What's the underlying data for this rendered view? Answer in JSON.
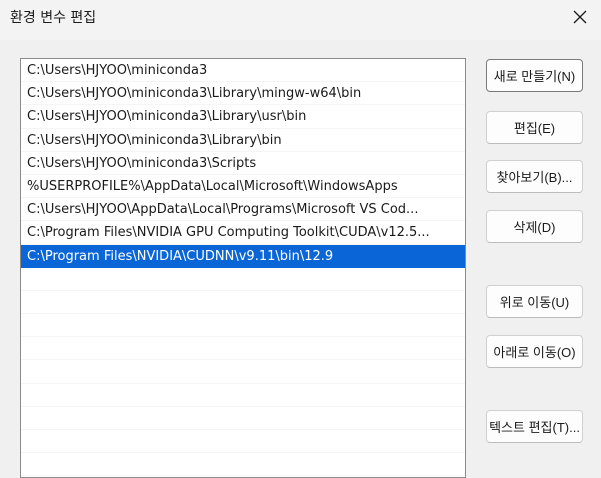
{
  "window": {
    "title": "환경 변수 편집"
  },
  "list": {
    "items": [
      "C:\\Users\\HJYOO\\miniconda3",
      "C:\\Users\\HJYOO\\miniconda3\\Library\\mingw-w64\\bin",
      "C:\\Users\\HJYOO\\miniconda3\\Library\\usr\\bin",
      "C:\\Users\\HJYOO\\miniconda3\\Library\\bin",
      "C:\\Users\\HJYOO\\miniconda3\\Scripts",
      "%USERPROFILE%\\AppData\\Local\\Microsoft\\WindowsApps",
      "C:\\Users\\HJYOO\\AppData\\Local\\Programs\\Microsoft VS Cod...",
      "C:\\Program Files\\NVIDIA GPU Computing Toolkit\\CUDA\\v12.5...",
      "C:\\Program Files\\NVIDIA\\CUDNN\\v9.11\\bin\\12.9"
    ],
    "selected_index": 8,
    "empty_rows": 9
  },
  "buttons": {
    "new": "새로 만들기(N)",
    "edit": "편집(E)",
    "browse": "찾아보기(B)...",
    "delete": "삭제(D)",
    "move_up": "위로 이동(U)",
    "move_down": "아래로 이동(O)",
    "edit_text": "텍스트 편집(T)..."
  },
  "colors": {
    "selection": "#0a66d6",
    "background": "#f0f0f0"
  },
  "icons": {
    "close": "close-icon"
  }
}
